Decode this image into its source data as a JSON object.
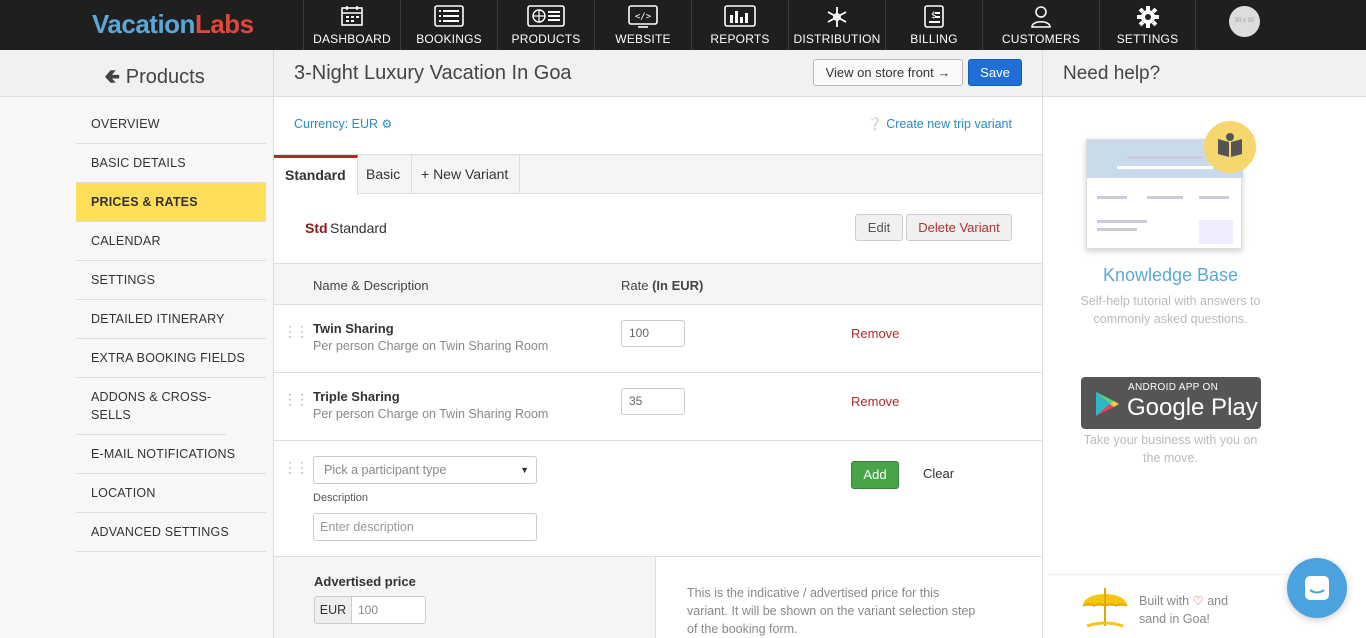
{
  "brand": {
    "part1": "Vacation",
    "part2": "Labs"
  },
  "nav": [
    {
      "label": "DASHBOARD",
      "icon": "calendar-icon"
    },
    {
      "label": "BOOKINGS",
      "icon": "list-icon"
    },
    {
      "label": "PRODUCTS",
      "icon": "globe-icon"
    },
    {
      "label": "WEBSITE",
      "icon": "code-icon"
    },
    {
      "label": "REPORTS",
      "icon": "chart-icon"
    },
    {
      "label": "DISTRIBUTION",
      "icon": "snowflake-icon"
    },
    {
      "label": "BILLING",
      "icon": "invoice-icon"
    },
    {
      "label": "CUSTOMERS",
      "icon": "user-icon"
    },
    {
      "label": "SETTINGS",
      "icon": "gear-icon"
    }
  ],
  "avatar": "30 x 30",
  "header": {
    "back_label": "Products",
    "title": "3-Night Luxury Vacation In Goa",
    "view_store_label": "View on store front →",
    "save_label": "Save",
    "help_title": "Need help?"
  },
  "sidebar": {
    "items": [
      {
        "label": "OVERVIEW"
      },
      {
        "label": "BASIC DETAILS"
      },
      {
        "label": "PRICES & RATES",
        "active": true
      },
      {
        "label": "CALENDAR"
      },
      {
        "label": "SETTINGS"
      },
      {
        "label": "DETAILED ITINERARY"
      },
      {
        "label": "EXTRA BOOKING FIELDS"
      },
      {
        "label": "ADDONS & CROSS-SELLS"
      },
      {
        "label": "E-MAIL NOTIFICATIONS"
      },
      {
        "label": "LOCATION"
      },
      {
        "label": "ADVANCED SETTINGS"
      }
    ]
  },
  "main": {
    "currency_label": "Currency: EUR",
    "create_variant_label": "Create new trip variant",
    "tabs": [
      {
        "label": "Standard",
        "active": true
      },
      {
        "label": "Basic"
      },
      {
        "label": "+ New Variant"
      }
    ],
    "variant": {
      "code": "Std",
      "name": "Standard",
      "edit_label": "Edit",
      "delete_label": "Delete Variant"
    },
    "table": {
      "col_name": "Name & Description",
      "col_rate_prefix": "Rate",
      "col_rate_unit": "(In EUR)",
      "rows": [
        {
          "name": "Twin Sharing",
          "desc": "Per person Charge on Twin Sharing Room",
          "rate": "100",
          "remove_label": "Remove"
        },
        {
          "name": "Triple Sharing",
          "desc": "Per person Charge on Twin Sharing Room",
          "rate": "35",
          "remove_label": "Remove"
        }
      ]
    },
    "new_row": {
      "participant_placeholder": "Pick a participant type",
      "description_label": "Description",
      "description_placeholder": "Enter description",
      "add_label": "Add",
      "clear_label": "Clear"
    },
    "advertised": {
      "title": "Advertised price",
      "currency": "EUR",
      "value": "100",
      "help_text": "This is the indicative / advertised price for this variant. It will be shown on the variant selection step of the booking form."
    }
  },
  "help": {
    "kb_title": "Knowledge Base",
    "kb_desc": "Self-help tutorial with answers to commonly asked questions.",
    "gplay_small": "ANDROID APP ON",
    "gplay_big": "Google Play",
    "gplay_desc": "Take your business with you on the move.",
    "built_prefix": "Built with",
    "built_suffix": "and",
    "built_line2": "sand in Goa!"
  },
  "colors": {
    "accent": "#ffdf57",
    "primary": "#1f6fd6",
    "link": "#2a8bbf",
    "danger": "#b02a2a",
    "success": "#47a447"
  }
}
